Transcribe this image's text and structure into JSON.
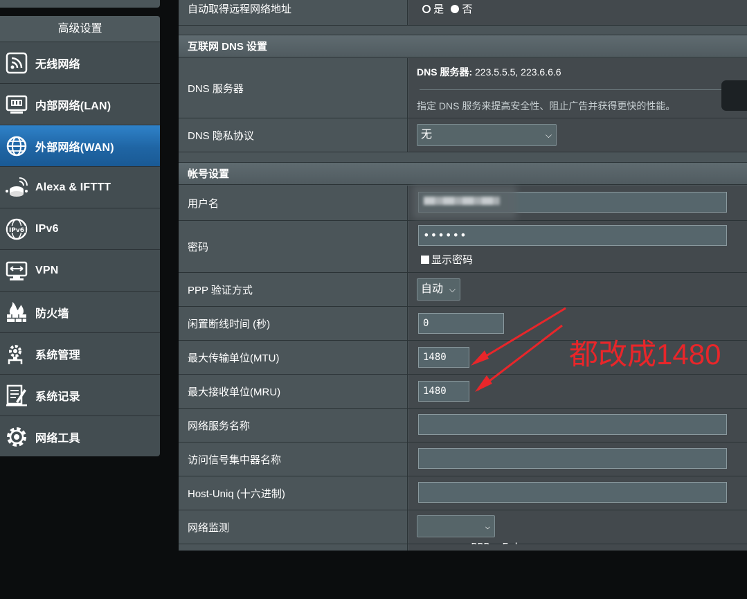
{
  "sidebar": {
    "title": "高级设置",
    "items": [
      {
        "label": "无线网络",
        "icon": "wireless-icon"
      },
      {
        "label": "内部网络(LAN)",
        "icon": "lan-icon"
      },
      {
        "label": "外部网络(WAN)",
        "icon": "globe-icon",
        "active": true
      },
      {
        "label": "Alexa & IFTTT",
        "icon": "alexa-icon"
      },
      {
        "label": "IPv6",
        "icon": "ipv6-icon"
      },
      {
        "label": "VPN",
        "icon": "vpn-icon"
      },
      {
        "label": "防火墙",
        "icon": "firewall-icon"
      },
      {
        "label": "系统管理",
        "icon": "admin-icon"
      },
      {
        "label": "系统记录",
        "icon": "log-icon"
      },
      {
        "label": "网络工具",
        "icon": "tools-icon"
      }
    ]
  },
  "remote": {
    "label": "自动取得远程网络地址",
    "yes": "是",
    "no": "否"
  },
  "dns_section": {
    "title": "互联网 DNS 设置",
    "server_label": "DNS 服务器",
    "server_prefix": "DNS 服务器:",
    "server_value": "223.5.5.5, 223.6.6.6",
    "server_hint": "指定 DNS 服务来提高安全性、阻止广告并获得更快的性能。",
    "privacy_label": "DNS 隐私协议",
    "privacy_value": "无"
  },
  "account": {
    "title": "帐号设置",
    "username_label": "用户名",
    "password_label": "密码",
    "password_value": "••••••",
    "show_password": "显示密码",
    "auth_label": "PPP 验证方式",
    "auth_value": "自动",
    "idle_label": "闲置断线时间 (秒)",
    "idle_value": "0",
    "mtu_label": "最大传输单位(MTU)",
    "mtu_value": "1480",
    "mru_label": "最大接收单位(MRU)",
    "mru_value": "1480",
    "service_label": "网络服务名称",
    "ac_label": "访问信号集中器名称",
    "hostuniq_label": "Host-Uniq (十六进制)",
    "monitor_label": "网络监测",
    "monitor_value": "PPP  Echo"
  },
  "annotation": {
    "text": "都改成1480",
    "color": "#e8262a"
  },
  "colors": {
    "active_menu": "#1f65a4",
    "panel": "#4b5559",
    "value_cell": "#43494d"
  }
}
